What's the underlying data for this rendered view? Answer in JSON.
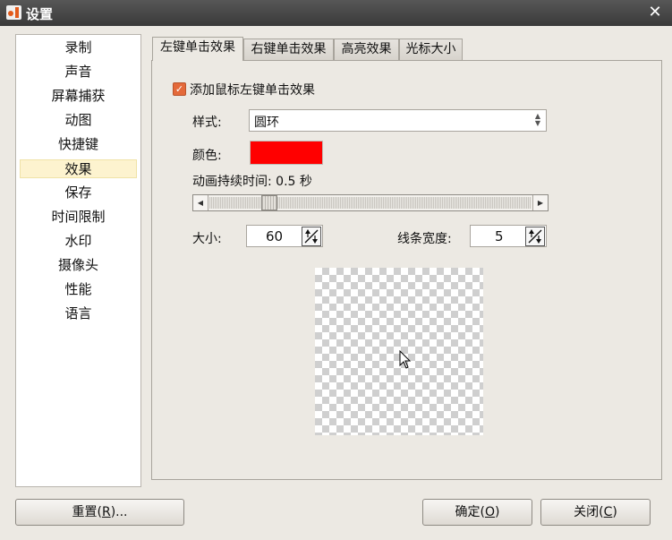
{
  "window": {
    "title": "设置",
    "close_icon": "close-icon",
    "app_icon": "recorder-app-icon"
  },
  "sidebar": {
    "items": [
      {
        "label": "录制"
      },
      {
        "label": "声音"
      },
      {
        "label": "屏幕捕获"
      },
      {
        "label": "动图"
      },
      {
        "label": "快捷键"
      },
      {
        "label": "效果",
        "selected": true
      },
      {
        "label": "保存"
      },
      {
        "label": "时间限制"
      },
      {
        "label": "水印"
      },
      {
        "label": "摄像头"
      },
      {
        "label": "性能"
      },
      {
        "label": "语言"
      }
    ]
  },
  "tabs": [
    {
      "label": "左键单击效果",
      "active": true
    },
    {
      "label": "右键单击效果"
    },
    {
      "label": "高亮效果"
    },
    {
      "label": "光标大小"
    }
  ],
  "panel": {
    "enable_checkbox": {
      "label": "添加鼠标左键单击效果",
      "checked": true
    },
    "style": {
      "label": "样式:",
      "value": "圆环"
    },
    "color": {
      "label": "颜色:",
      "value": "#ff0000"
    },
    "duration": {
      "label": "动画持续时间: 0.5 秒",
      "fraction": 0.17
    },
    "size": {
      "label": "大小:",
      "value": "60"
    },
    "line_width": {
      "label": "线条宽度:",
      "value": "5"
    }
  },
  "footer": {
    "reset": {
      "text": "重置(",
      "key": "R",
      "suffix": ")..."
    },
    "ok": {
      "text": "确定(",
      "key": "O",
      "suffix": ")"
    },
    "close": {
      "text": "关闭(",
      "key": "C",
      "suffix": ")"
    }
  }
}
